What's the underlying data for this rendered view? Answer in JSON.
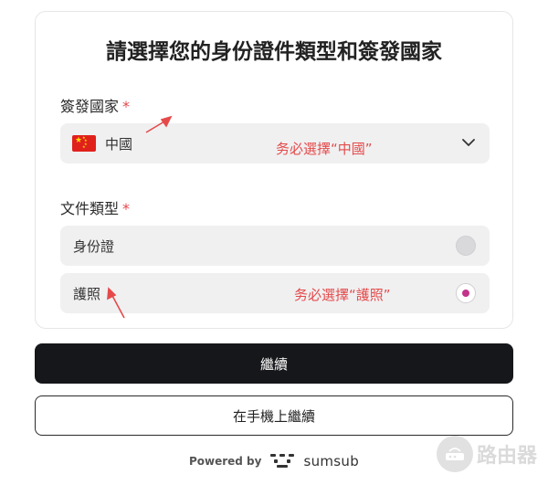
{
  "form": {
    "title": "請選擇您的身份證件類型和簽發國家",
    "country_label": "簽發國家",
    "required_mark": "*",
    "country_flag_icon": "china-flag-icon",
    "country_value": "中國",
    "doc_type_label": "文件類型",
    "options": [
      {
        "label": "身份證",
        "selected": false
      },
      {
        "label": "護照",
        "selected": true
      }
    ]
  },
  "annotations": {
    "country_note": "务必選擇“中國”",
    "doc_note": "务必選擇“護照”"
  },
  "buttons": {
    "continue_label": "繼續",
    "continue_on_phone_label": "在手機上繼續"
  },
  "footer": {
    "powered_by": "Powered by",
    "brand_name": "sumsub"
  },
  "watermark": {
    "text": "路由器"
  },
  "colors": {
    "accent_radio": "#c2338a",
    "required": "#e5484d",
    "annotation": "#e54a4a",
    "primary_button": "#16171b"
  }
}
